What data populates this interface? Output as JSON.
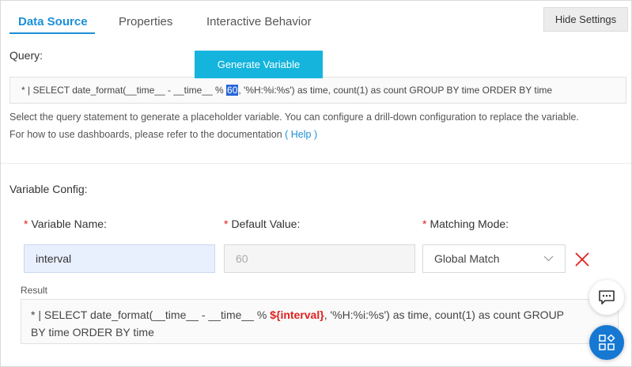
{
  "tabs": [
    {
      "label": "Data Source",
      "active": true
    },
    {
      "label": "Properties",
      "active": false
    },
    {
      "label": "Interactive Behavior",
      "active": false
    }
  ],
  "hide_settings_label": "Hide Settings",
  "query": {
    "label": "Query:",
    "generate_button": "Generate Variable",
    "text_before": "* | SELECT date_format(__time__ - __time__ % ",
    "selected": "60",
    "text_after": ", '%H:%i:%s') as time, count(1) as count GROUP BY time ORDER BY time"
  },
  "hint": {
    "line1": "Select the query statement to generate a placeholder variable. You can configure a drill-down configuration to replace the variable.",
    "line2": "For how to use dashboards, please refer to the documentation",
    "help_link": "( Help )"
  },
  "variable_config": {
    "label": "Variable Config:",
    "name_label": "Variable Name:",
    "default_label": "Default Value:",
    "mode_label": "Matching Mode:",
    "required_mark": "*",
    "name_value": "interval",
    "default_value": "60",
    "mode_value": "Global Match"
  },
  "result": {
    "label": "Result",
    "before": "* | SELECT date_format(__time__ - __time__ % ",
    "variable": "${interval}",
    "after": ", '%H:%i:%s') as time, count(1) as count GROUP",
    "line2": "BY time ORDER BY time"
  },
  "colors": {
    "accent": "#1a8fd8",
    "generate_button": "#14b4dd",
    "required": "#e02020",
    "fab": "#1678d3"
  },
  "icons": [
    "chevron-down-icon",
    "close-icon",
    "chat-icon",
    "apps-icon"
  ]
}
